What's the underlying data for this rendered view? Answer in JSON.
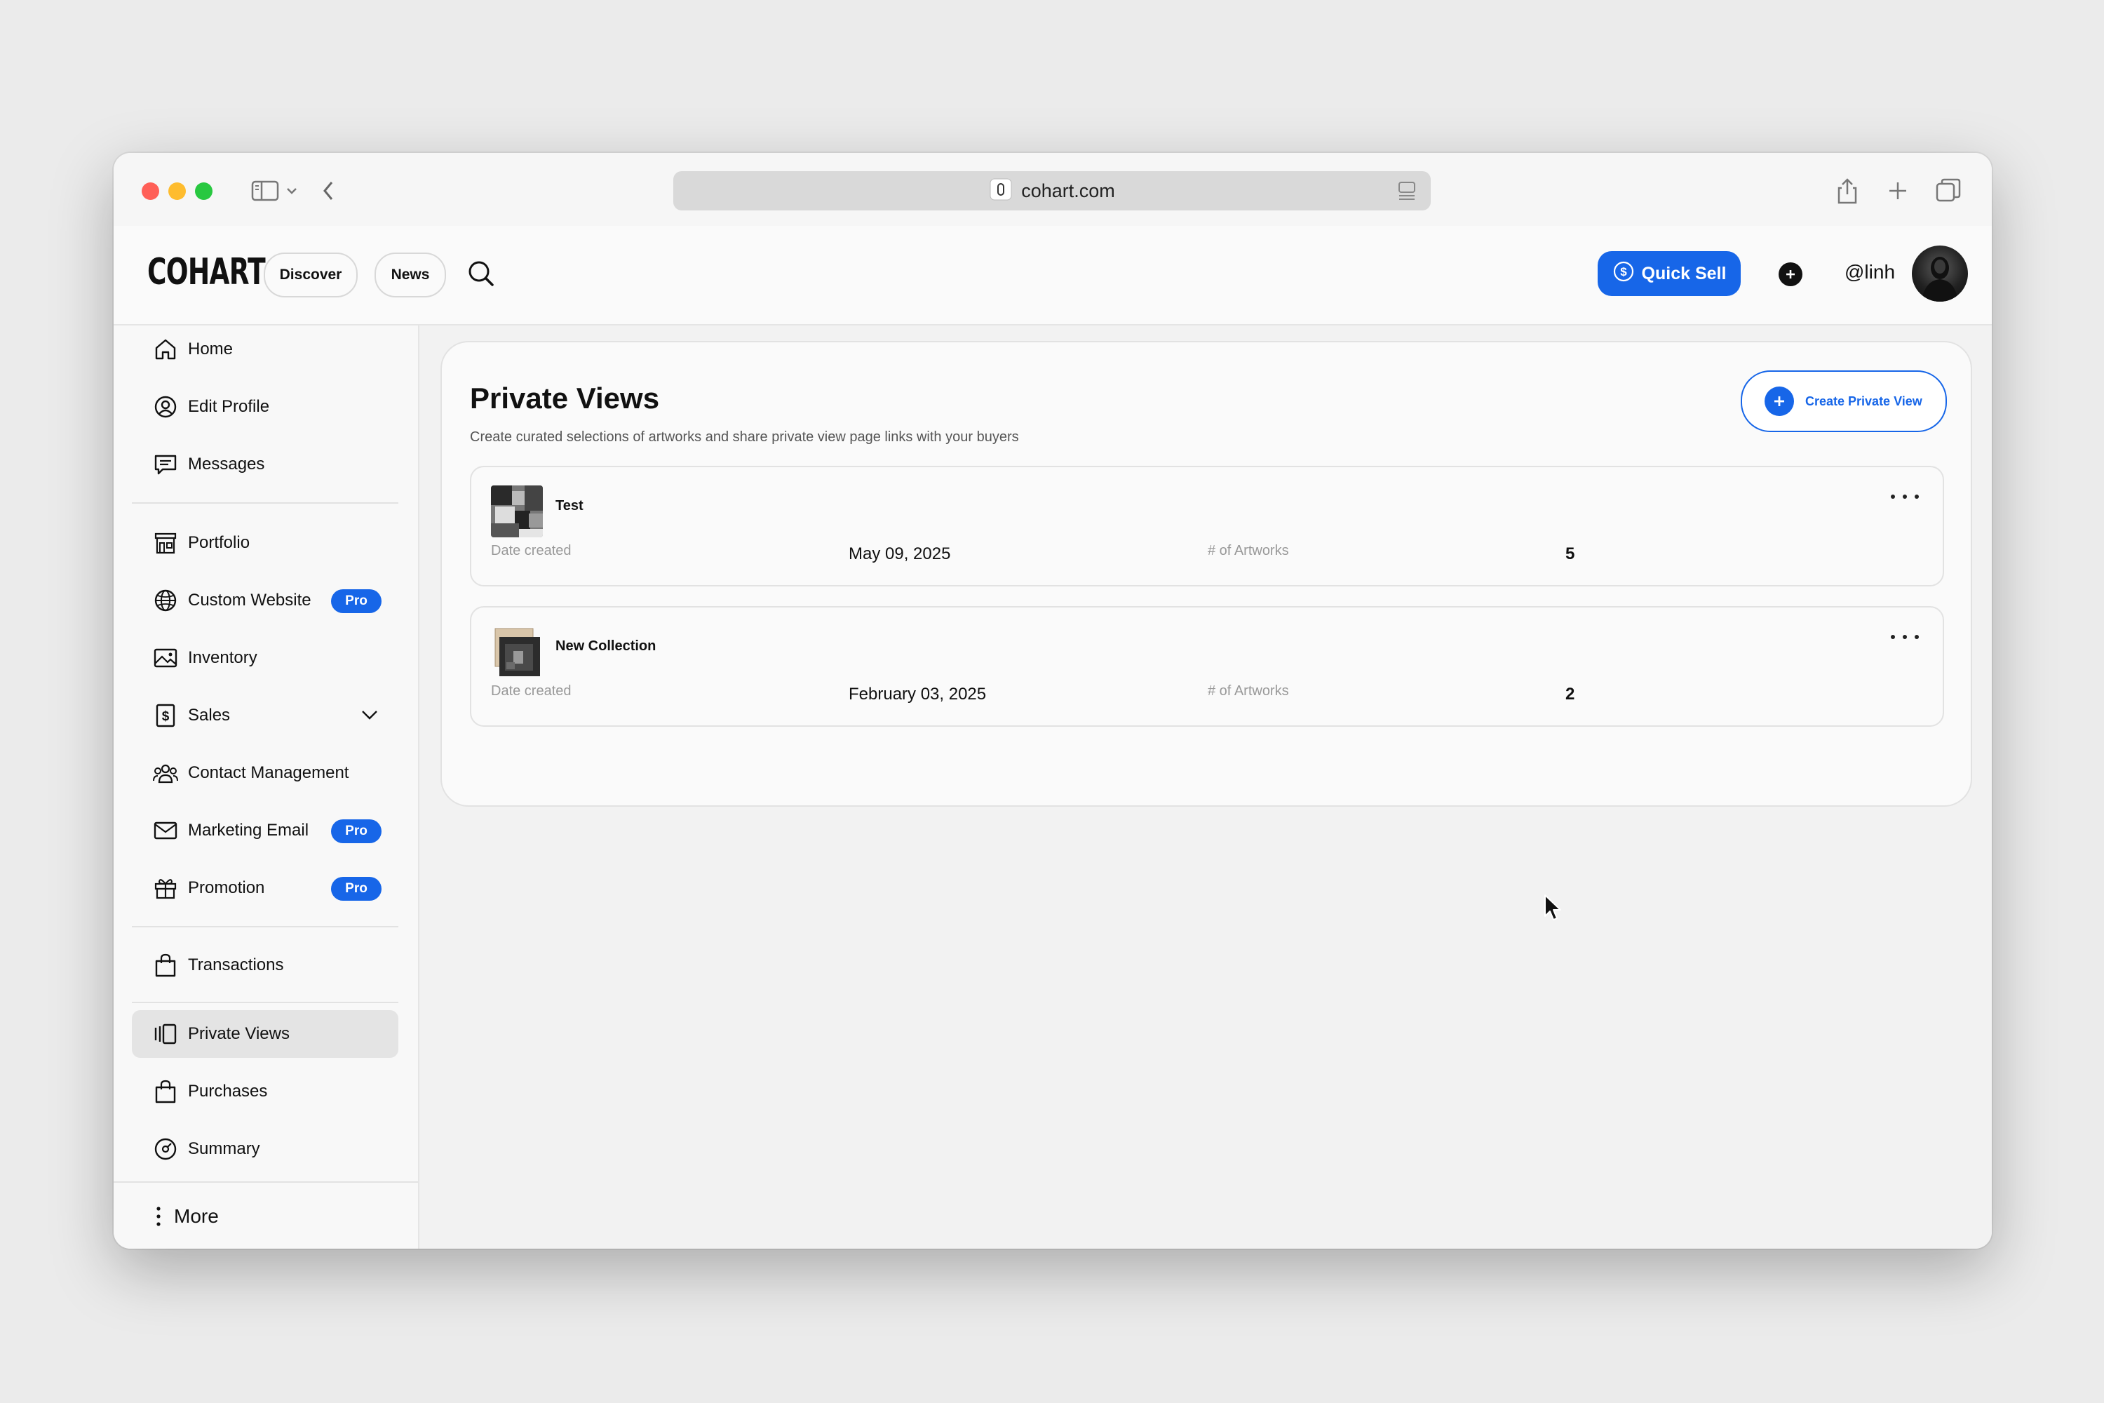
{
  "browser": {
    "url": "cohart.com"
  },
  "header": {
    "logo": "COHART",
    "nav": {
      "discover": "Discover",
      "news": "News"
    },
    "quick_sell": "Quick Sell",
    "username": "@linh",
    "accent_color": "#1766e8"
  },
  "sidebar": {
    "items": [
      {
        "label": "Home",
        "icon": "home-icon"
      },
      {
        "label": "Edit Profile",
        "icon": "user-circle-icon"
      },
      {
        "label": "Messages",
        "icon": "message-icon"
      },
      {
        "label": "Portfolio",
        "icon": "storefront-icon"
      },
      {
        "label": "Custom Website",
        "icon": "globe-icon",
        "badge": "Pro"
      },
      {
        "label": "Inventory",
        "icon": "image-icon"
      },
      {
        "label": "Sales",
        "icon": "dollar-doc-icon"
      },
      {
        "label": "Contact Management",
        "icon": "contacts-icon"
      },
      {
        "label": "Marketing Email",
        "icon": "mail-icon",
        "badge": "Pro"
      },
      {
        "label": "Promotion",
        "icon": "gift-icon",
        "badge": "Pro"
      },
      {
        "label": "Transactions",
        "icon": "bag-icon"
      },
      {
        "label": "Private Views",
        "icon": "private-views-icon",
        "active": true
      },
      {
        "label": "Purchases",
        "icon": "bag-icon"
      },
      {
        "label": "Summary",
        "icon": "gauge-icon"
      }
    ],
    "more": "More"
  },
  "main": {
    "title": "Private Views",
    "subtitle": "Create curated selections of artworks and share private view page links with your buyers",
    "create_button": "Create Private View",
    "views": [
      {
        "name": "Test",
        "date_label": "Date created",
        "date": "May 09, 2025",
        "count_label": "# of Artworks",
        "count": "5"
      },
      {
        "name": "New Collection",
        "date_label": "Date created",
        "date": "February 03, 2025",
        "count_label": "# of Artworks",
        "count": "2"
      }
    ]
  }
}
